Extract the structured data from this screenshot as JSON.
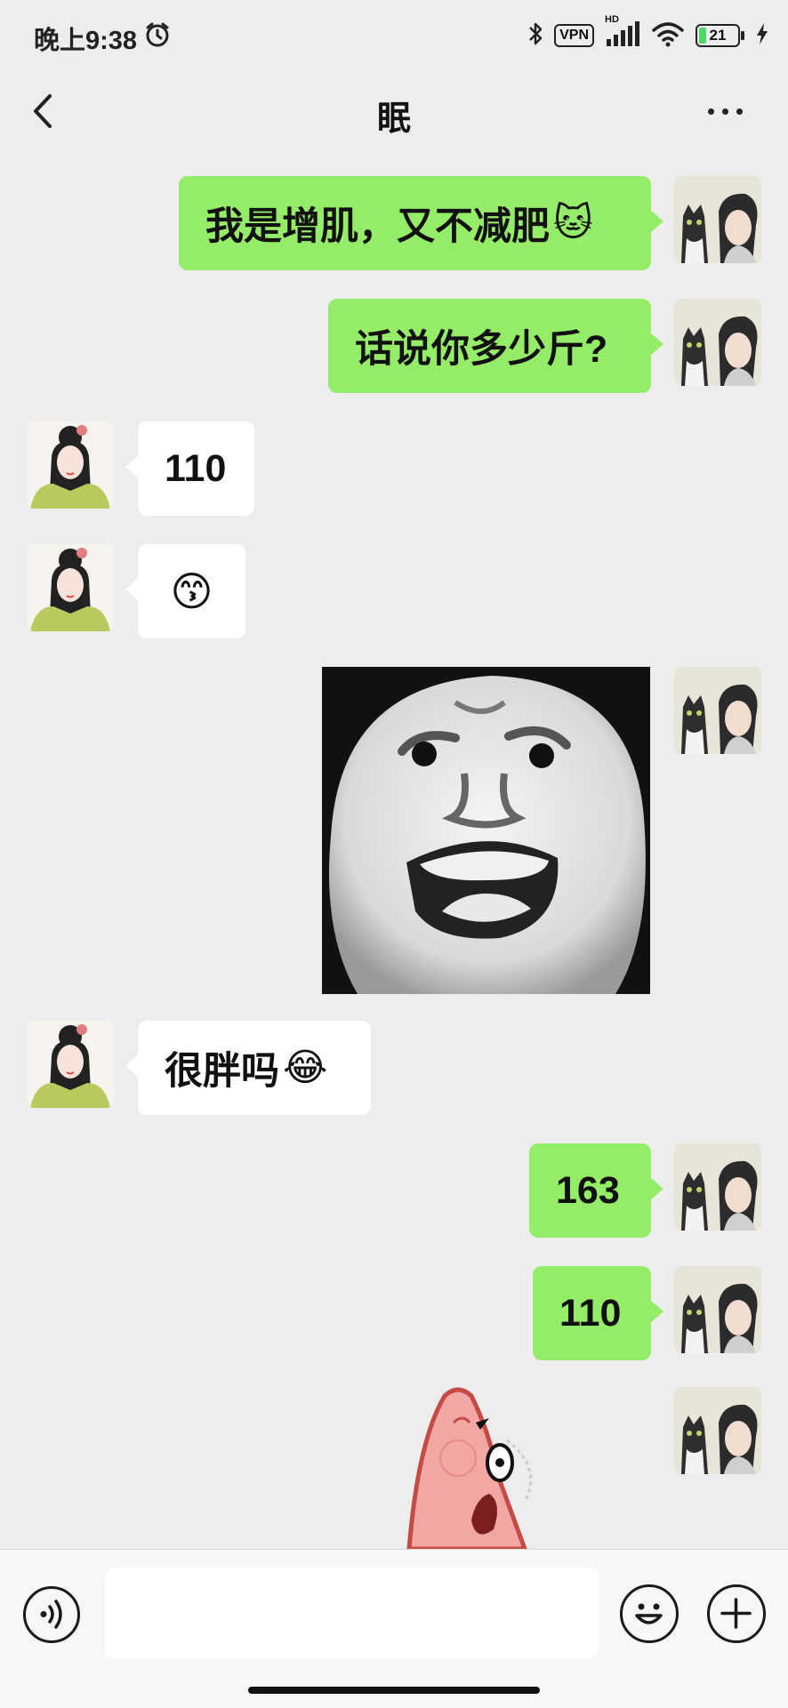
{
  "status": {
    "time": "晚上9:38",
    "vpn": "VPN",
    "hd": "HD",
    "battery": "21"
  },
  "header": {
    "title": "眠"
  },
  "messages": [
    {
      "from": "me",
      "text": "我是增肌，又不减肥",
      "emoji": "🐱"
    },
    {
      "from": "me",
      "text": "话说你多少斤?"
    },
    {
      "from": "other",
      "text": "110"
    },
    {
      "from": "other",
      "text": "",
      "emoji": "😙"
    },
    {
      "from": "me",
      "type": "sticker",
      "sticker": "shocked-face-sticker"
    },
    {
      "from": "other",
      "text": "很胖吗",
      "emoji": "😂"
    },
    {
      "from": "me",
      "text": "163"
    },
    {
      "from": "me",
      "text": "110"
    },
    {
      "from": "me",
      "type": "sticker",
      "sticker": "patrick-star-sticker"
    }
  ],
  "icons": {
    "back": "chevron-left-icon",
    "more": "more-dots-icon",
    "voice": "voice-icon",
    "emoji": "smiley-icon",
    "plus": "plus-icon"
  },
  "colors": {
    "my_bubble": "#95ec69",
    "other_bubble": "#ffffff",
    "background": "#ededed"
  }
}
